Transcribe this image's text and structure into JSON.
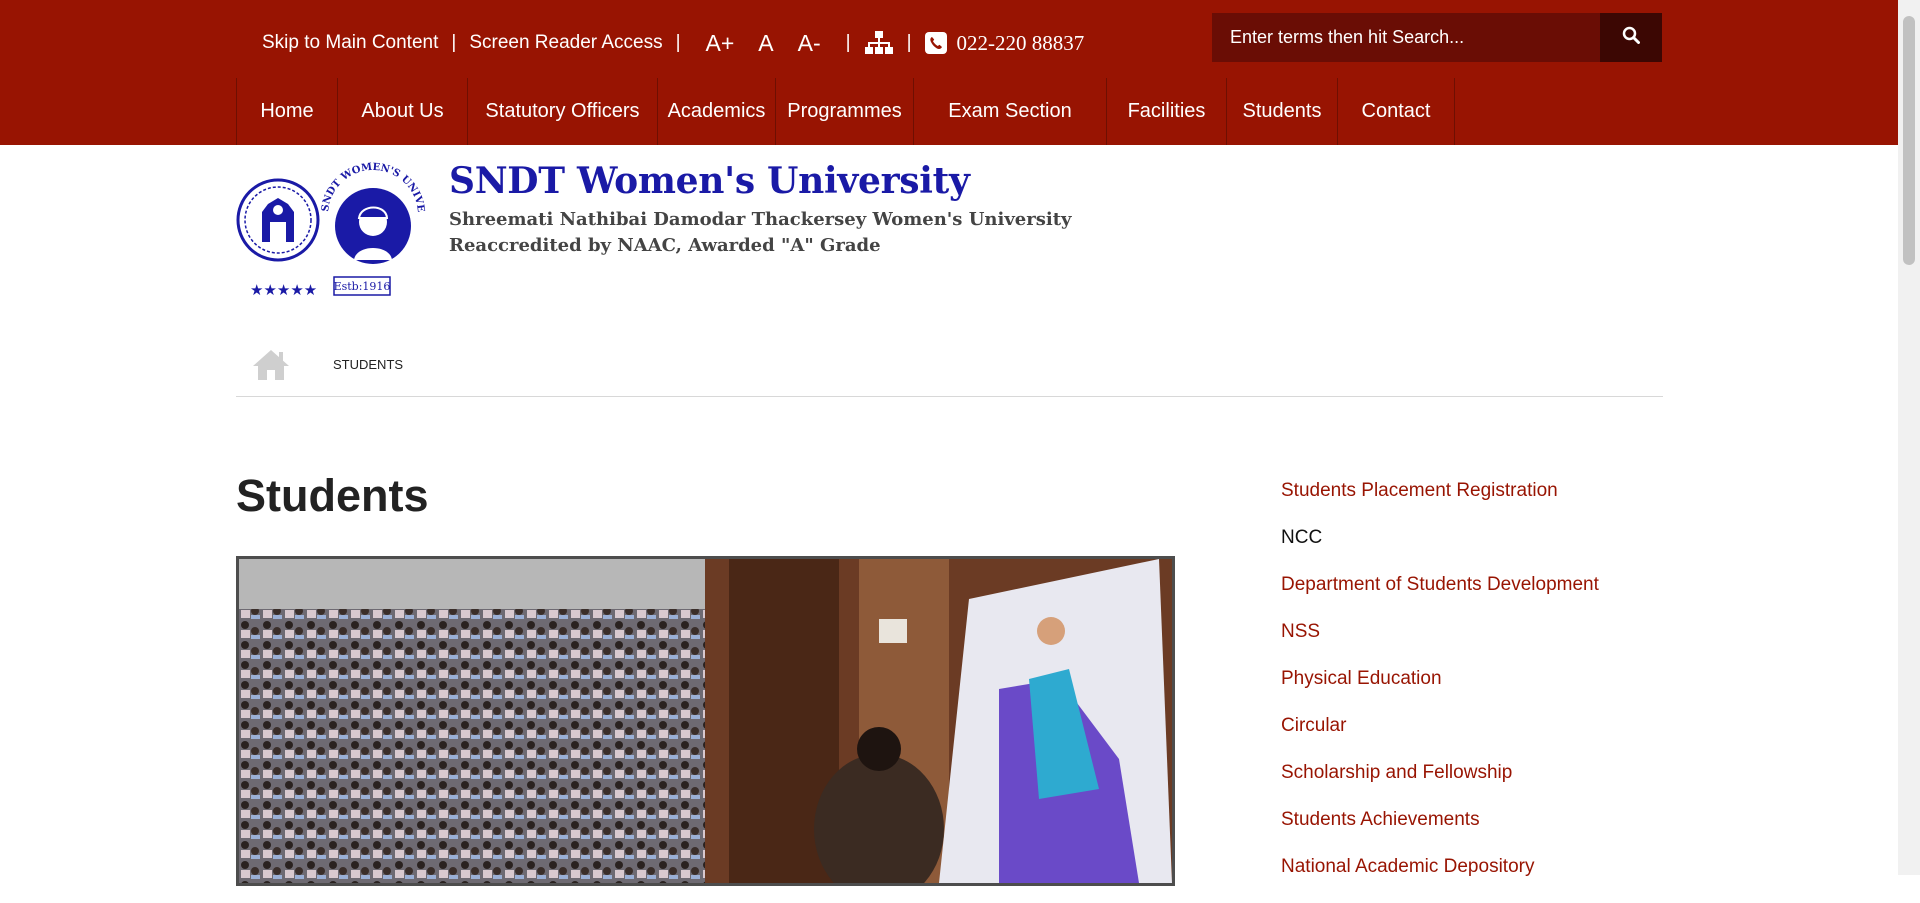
{
  "topbar": {
    "skip_label": "Skip to Main Content",
    "sep": "|",
    "reader_label": "Screen Reader Access",
    "font_increase": "A+",
    "font_normal": "A",
    "font_decrease": "A-",
    "sitemap_icon": "sitemap-icon",
    "phone_icon": "phone-icon",
    "phone": "022-220 88837"
  },
  "search": {
    "placeholder": "Enter terms then hit Search...",
    "icon": "search-icon"
  },
  "nav": {
    "items": [
      "Home",
      "About Us",
      "Statutory Officers",
      "Academics",
      "Programmes",
      "Exam Section",
      "Facilities",
      "Students",
      "Contact"
    ]
  },
  "brand": {
    "name": "SNDT Women's University",
    "subtitle": "Shreemati Nathibai Damodar Thackersey Women's University",
    "accreditation": "Reaccredited by NAAC, Awarded \"A\" Grade",
    "logo_text": "SNDT WOMEN'S UNIVERSITY",
    "logo_estd": "Estb:1916"
  },
  "breadcrumb": {
    "home_icon": "home-icon",
    "current": "STUDENTS"
  },
  "page": {
    "title": "Students"
  },
  "sidebar": {
    "links": [
      {
        "label": "Students Placement Registration",
        "active": false
      },
      {
        "label": "NCC",
        "active": true
      },
      {
        "label": "Department of Students Development",
        "active": false
      },
      {
        "label": "NSS",
        "active": false
      },
      {
        "label": "Physical Education",
        "active": false
      },
      {
        "label": "Circular",
        "active": false
      },
      {
        "label": "Scholarship and Fellowship",
        "active": false
      },
      {
        "label": "Students Achievements",
        "active": false
      },
      {
        "label": "National Academic Depository",
        "active": false
      }
    ]
  },
  "colors": {
    "brand_red": "#981402",
    "link_red": "#981402",
    "navy": "#1a1aa6"
  }
}
